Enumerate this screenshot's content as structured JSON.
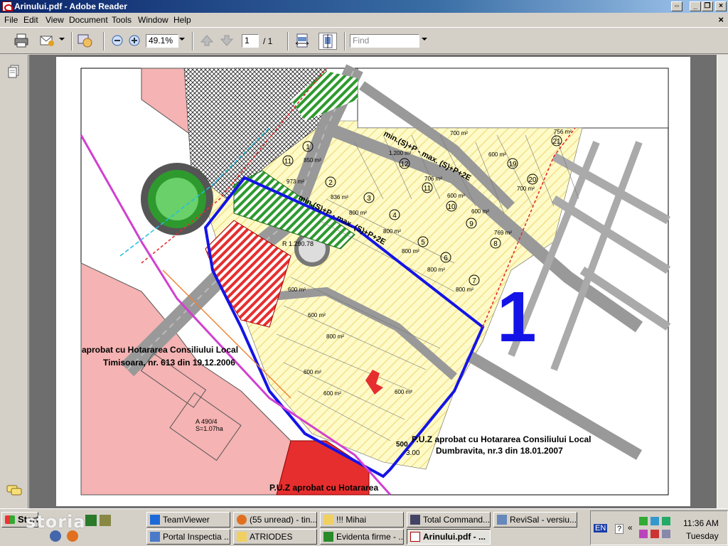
{
  "window": {
    "title": "Arinului.pdf - Adobe Reader",
    "buttons": [
      "restore-down",
      "minimize",
      "maximize",
      "close"
    ]
  },
  "menu": {
    "items": [
      "File",
      "Edit",
      "View",
      "Document",
      "Tools",
      "Window",
      "Help"
    ],
    "close_label": "×"
  },
  "toolbar": {
    "zoom_value": "49.1%",
    "page_current": "1",
    "page_total": "/ 1",
    "find_placeholder": "Find"
  },
  "map": {
    "plot_number": "1",
    "labels": [
      {
        "text": "aprobat cu Hotararea Consiliului Local"
      },
      {
        "text": "Timisoara, nr. 613 din 19.12.2006"
      },
      {
        "text": "P.U.Z aprobat cu Hotararea Consiliului Local"
      },
      {
        "text": "Dumbravita, nr.3 din 18.01.2007"
      },
      {
        "text": "P.U.Z aprobat cu Hotararea"
      },
      {
        "text": "A 490/4"
      },
      {
        "text": "S=1.07ha"
      },
      {
        "text": "min.(S)+P - max. (S)+P+2E"
      },
      {
        "text": "min.(S)+P - max. (S)+P+2E"
      },
      {
        "text": "R 1.290.78"
      },
      {
        "text": "500"
      },
      {
        "text": "3.00"
      }
    ],
    "areas": [
      "700 m²",
      "756 m²",
      "1.200 m²",
      "850 m²",
      "973 m²",
      "836 m²",
      "600 m²",
      "706 m²",
      "700 m²",
      "600 m²",
      "600 m²",
      "800 m²",
      "800 m²",
      "769 m²",
      "800 m²",
      "800 m²",
      "800 m²",
      "600 m²",
      "600 m²",
      "800 m²",
      "600 m²",
      "600 m²",
      "600 m²"
    ],
    "lot_numbers": [
      "21",
      "19",
      "20",
      "12",
      "11",
      "10",
      "9",
      "8",
      "7",
      "6",
      "5",
      "4",
      "3",
      "2",
      "1",
      "11"
    ],
    "colors": {
      "residential": "#fffbc8",
      "pink_zone": "#f5b3b3",
      "green": "#2e9a2e",
      "red": "#e62e2e",
      "blue_boundary": "#1414e6",
      "road": "#8a8a8a"
    }
  },
  "leftnav": {
    "icons": [
      "pages-icon",
      "comments-icon"
    ]
  },
  "taskbar": {
    "start_label": "Start",
    "watermark": "storia",
    "tasks_row1": [
      "TeamViewer",
      "(55 unread) - tin...",
      "!!! Mihai",
      "Total Command...",
      "ReviSal - versiu..."
    ],
    "tasks_row2": [
      "Portal Inspectia ...",
      "ATRIODES",
      "Evidenta firme - ...",
      "Arinului.pdf - ..."
    ],
    "lang": "EN",
    "clock_time": "11:36 AM",
    "clock_day": "Tuesday"
  }
}
